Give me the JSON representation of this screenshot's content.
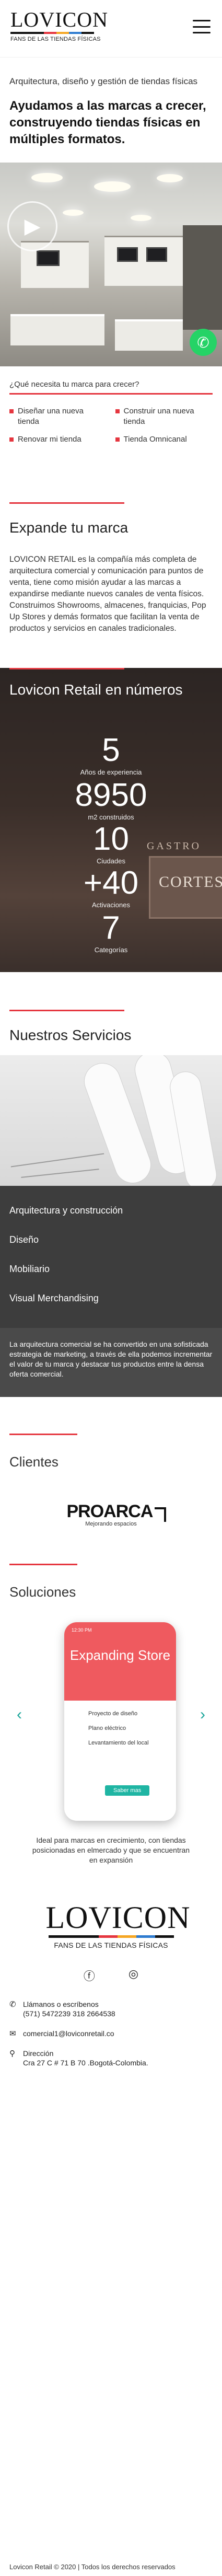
{
  "brand": {
    "name": "LOVICON",
    "tagline": "FANS DE LAS TIENDAS FÍSICAS"
  },
  "header": {
    "menu_icon": "hamburger-icon"
  },
  "intro": {
    "subtitle": "Arquitectura, diseño y gestión de tiendas físicas",
    "headline": "Ayudamos a las marcas a crecer, construyendo tiendas físicas en múltiples formatos."
  },
  "whatsapp": {
    "icon": "whatsapp-icon"
  },
  "needs": {
    "question": "¿Qué necesita tu marca para crecer?",
    "options": [
      "Diseñar una nueva tienda",
      "Construir una nueva tienda",
      "Renovar mi tienda",
      "Tienda Omnicanal"
    ]
  },
  "expand": {
    "title": "Expande tu marca",
    "text": "LOVICON RETAIL es la compañía más completa de arquitectura comercial y comunicación para puntos de venta, tiene como misión ayudar a las marcas a expandirse mediante nuevos canales de venta físicos. Construimos Showrooms, almacenes, franquicias, Pop Up Stores y demás formatos que facilitan la venta de productos y servicios en canales tradicionales."
  },
  "numbers": {
    "title": "Lovicon Retail en números",
    "stats": [
      {
        "value": "5",
        "label": "Años de experiencia"
      },
      {
        "value": "8950",
        "label": "m2 construidos"
      },
      {
        "value": "10",
        "label": "Ciudades"
      },
      {
        "value": "+40",
        "label": "Activaciones"
      },
      {
        "value": "7",
        "label": "Categorías"
      }
    ]
  },
  "services": {
    "title": "Nuestros Servicios",
    "items": [
      "Arquitectura y construcción",
      "Diseño",
      "Mobiliario",
      "Visual Merchandising"
    ],
    "description": "La arquitectura comercial se ha convertido en una sofisticada estrategia de marketing, a través de ella podemos incrementar el valor de tu marca y destacar tus productos entre la densa oferta comercial."
  },
  "clients": {
    "title": "Clientes",
    "logo_name": "PROARCA",
    "logo_sub": "Mejorando espacios"
  },
  "solutions": {
    "title": "Soluciones",
    "card": {
      "time": "12:30 PM",
      "title": "Expanding Store",
      "items": [
        "Proyecto de diseño",
        "Plano eléctrico",
        "Levantamiento del local"
      ],
      "button": "Saber mas"
    },
    "text": "Ideal para marcas en crecimiento, con tiendas posicionadas en elmercado y que se encuentran en expansión"
  },
  "footer": {
    "social": [
      "facebook-icon",
      "instagram-icon"
    ],
    "phone_label": "Llámanos o escríbenos",
    "phones": "(571) 5472239 318 2664538",
    "email": "comercial1@loviconretail.co",
    "address_label": "Dirección",
    "address": "Cra 27 C # 71 B 70 .Bogotá-Colombia.",
    "copyright": "Lovicon Retail © 2020 | Todos los derechos reservados"
  }
}
